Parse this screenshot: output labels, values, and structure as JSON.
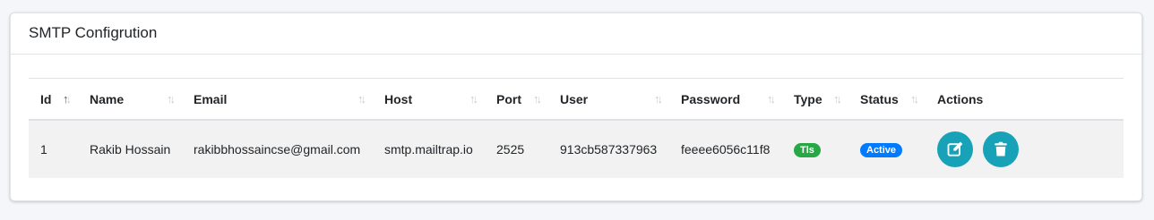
{
  "card": {
    "title": "SMTP Configrution"
  },
  "table": {
    "columns": [
      "Id",
      "Name",
      "Email",
      "Host",
      "Port",
      "User",
      "Password",
      "Type",
      "Status",
      "Actions"
    ],
    "rows": [
      {
        "id": "1",
        "name": "Rakib Hossain",
        "email": "rakibbhossaincse@gmail.com",
        "host": "smtp.mailtrap.io",
        "port": "2525",
        "user": "913cb587337963",
        "password": "feeee6056c11f8",
        "type": "Tls",
        "status": "Active"
      }
    ]
  },
  "icons": {
    "sort": "sort-icon",
    "edit": "edit-icon",
    "delete": "trash-icon"
  },
  "colors": {
    "action": "#17a2b8",
    "tls": "#28a745",
    "active": "#007bff"
  }
}
